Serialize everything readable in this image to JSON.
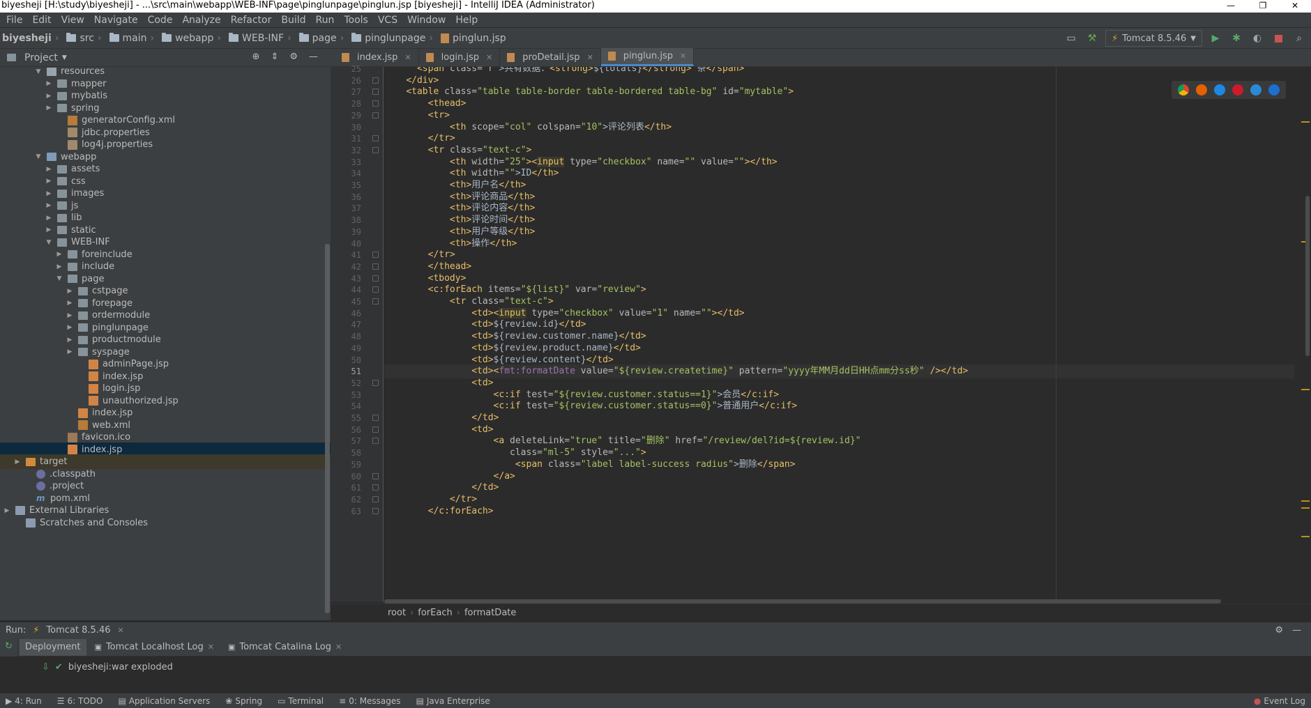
{
  "window": {
    "title": "biyesheji [H:\\study\\biyesheji] - ...\\src\\main\\webapp\\WEB-INF\\page\\pinglunpage\\pinglun.jsp [biyesheji] - IntelliJ IDEA (Administrator)"
  },
  "menu": [
    "File",
    "Edit",
    "View",
    "Navigate",
    "Code",
    "Analyze",
    "Refactor",
    "Build",
    "Run",
    "Tools",
    "VCS",
    "Window",
    "Help"
  ],
  "breadcrumb": [
    "biyesheji",
    "src",
    "main",
    "webapp",
    "WEB-INF",
    "page",
    "pinglunpage",
    "pinglun.jsp"
  ],
  "run_config": "Tomcat 8.5.46",
  "project_panel": {
    "title": "Project"
  },
  "tree": [
    {
      "label": "resources",
      "depth": 3,
      "kind": "fold res",
      "open": true
    },
    {
      "label": "mapper",
      "depth": 4,
      "kind": "fold",
      "open": false
    },
    {
      "label": "mybatis",
      "depth": 4,
      "kind": "fold",
      "open": false
    },
    {
      "label": "spring",
      "depth": 4,
      "kind": "fold",
      "open": false
    },
    {
      "label": "generatorConfig.xml",
      "depth": 5,
      "kind": "xml"
    },
    {
      "label": "jdbc.properties",
      "depth": 5,
      "kind": "prop"
    },
    {
      "label": "log4j.properties",
      "depth": 5,
      "kind": "prop"
    },
    {
      "label": "webapp",
      "depth": 3,
      "kind": "fold web",
      "open": true
    },
    {
      "label": "assets",
      "depth": 4,
      "kind": "fold",
      "open": false
    },
    {
      "label": "css",
      "depth": 4,
      "kind": "fold",
      "open": false
    },
    {
      "label": "images",
      "depth": 4,
      "kind": "fold",
      "open": false
    },
    {
      "label": "js",
      "depth": 4,
      "kind": "fold",
      "open": false
    },
    {
      "label": "lib",
      "depth": 4,
      "kind": "fold",
      "open": false
    },
    {
      "label": "static",
      "depth": 4,
      "kind": "fold",
      "open": false
    },
    {
      "label": "WEB-INF",
      "depth": 4,
      "kind": "fold",
      "open": true
    },
    {
      "label": "foreinclude",
      "depth": 5,
      "kind": "fold",
      "open": false
    },
    {
      "label": "include",
      "depth": 5,
      "kind": "fold",
      "open": false
    },
    {
      "label": "page",
      "depth": 5,
      "kind": "fold",
      "open": true
    },
    {
      "label": "cstpage",
      "depth": 6,
      "kind": "fold",
      "open": false
    },
    {
      "label": "forepage",
      "depth": 6,
      "kind": "fold",
      "open": false
    },
    {
      "label": "ordermodule",
      "depth": 6,
      "kind": "fold",
      "open": false
    },
    {
      "label": "pinglunpage",
      "depth": 6,
      "kind": "fold",
      "open": false
    },
    {
      "label": "productmodule",
      "depth": 6,
      "kind": "fold",
      "open": false
    },
    {
      "label": "syspage",
      "depth": 6,
      "kind": "fold",
      "open": false
    },
    {
      "label": "adminPage.jsp",
      "depth": 7,
      "kind": "jsp"
    },
    {
      "label": "index.jsp",
      "depth": 7,
      "kind": "jsp"
    },
    {
      "label": "login.jsp",
      "depth": 7,
      "kind": "jsp"
    },
    {
      "label": "unauthorized.jsp",
      "depth": 7,
      "kind": "jsp"
    },
    {
      "label": "index.jsp",
      "depth": 6,
      "kind": "jsp"
    },
    {
      "label": "web.xml",
      "depth": 6,
      "kind": "xml"
    },
    {
      "label": "favicon.ico",
      "depth": 5,
      "kind": "ico"
    },
    {
      "label": "index.jsp",
      "depth": 5,
      "kind": "jsp",
      "selected": true
    },
    {
      "label": "target",
      "depth": 1,
      "kind": "fold target",
      "open": false,
      "highlight": true
    },
    {
      "label": ".classpath",
      "depth": 2,
      "kind": "cp"
    },
    {
      "label": ".project",
      "depth": 2,
      "kind": "cp"
    },
    {
      "label": "pom.xml",
      "depth": 2,
      "kind": "pom"
    },
    {
      "label": "External Libraries",
      "depth": 0,
      "kind": "lib",
      "open": false
    },
    {
      "label": "Scratches and Consoles",
      "depth": 1,
      "kind": "lib"
    }
  ],
  "tabs": [
    {
      "label": "index.jsp",
      "active": false
    },
    {
      "label": "login.jsp",
      "active": false
    },
    {
      "label": "proDetail.jsp",
      "active": false
    },
    {
      "label": "pinglun.jsp",
      "active": true
    }
  ],
  "code": {
    "first_line": 25,
    "current_line": 51,
    "lines": [
      [
        [
          "      ",
          "x"
        ],
        [
          "<span ",
          "t"
        ],
        [
          "class=",
          "a"
        ],
        [
          "\"r\"",
          "s"
        ],
        [
          ">共有数据：",
          "x"
        ],
        [
          "<strong>",
          "t"
        ],
        [
          "${totals}",
          "x"
        ],
        [
          "</strong>",
          "t"
        ],
        [
          " 条",
          "x"
        ],
        [
          "</span>",
          "t"
        ]
      ],
      [
        [
          "    ",
          "x"
        ],
        [
          "</div>",
          "t"
        ]
      ],
      [
        [
          "    ",
          "x"
        ],
        [
          "<table ",
          "t"
        ],
        [
          "class=",
          "a"
        ],
        [
          "\"table table-border table-bordered table-bg\"",
          "s"
        ],
        [
          " id=",
          "a"
        ],
        [
          "\"mytable\"",
          "s"
        ],
        [
          ">",
          "t"
        ]
      ],
      [
        [
          "        ",
          "x"
        ],
        [
          "<thead>",
          "t"
        ]
      ],
      [
        [
          "        ",
          "x"
        ],
        [
          "<tr>",
          "t"
        ]
      ],
      [
        [
          "            ",
          "x"
        ],
        [
          "<th ",
          "t"
        ],
        [
          "scope=",
          "a"
        ],
        [
          "\"col\"",
          "s"
        ],
        [
          " colspan=",
          "a"
        ],
        [
          "\"10\"",
          "s"
        ],
        [
          ">评论列表",
          "x"
        ],
        [
          "</th>",
          "t"
        ]
      ],
      [
        [
          "        ",
          "x"
        ],
        [
          "</tr>",
          "t"
        ]
      ],
      [
        [
          "        ",
          "x"
        ],
        [
          "<tr ",
          "t"
        ],
        [
          "class=",
          "a"
        ],
        [
          "\"text-c\"",
          "s"
        ],
        [
          ">",
          "t"
        ]
      ],
      [
        [
          "            ",
          "x"
        ],
        [
          "<th ",
          "t"
        ],
        [
          "width=",
          "a"
        ],
        [
          "\"25\"",
          "s"
        ],
        [
          "><",
          "t"
        ],
        [
          "input",
          "t"
        ],
        [
          " type=",
          "a"
        ],
        [
          "\"checkbox\"",
          "s"
        ],
        [
          " name=",
          "a"
        ],
        [
          "\"\"",
          "s"
        ],
        [
          " value=",
          "a"
        ],
        [
          "\"\"",
          "s"
        ],
        [
          "></th>",
          "t"
        ]
      ],
      [
        [
          "            ",
          "x"
        ],
        [
          "<th ",
          "t"
        ],
        [
          "width=",
          "a"
        ],
        [
          "\"\"",
          "s"
        ],
        [
          ">ID",
          "x"
        ],
        [
          "</th>",
          "t"
        ]
      ],
      [
        [
          "            ",
          "x"
        ],
        [
          "<th>",
          "t"
        ],
        [
          "用户名",
          "x"
        ],
        [
          "</th>",
          "t"
        ]
      ],
      [
        [
          "            ",
          "x"
        ],
        [
          "<th>",
          "t"
        ],
        [
          "评论商品",
          "x"
        ],
        [
          "</th>",
          "t"
        ]
      ],
      [
        [
          "            ",
          "x"
        ],
        [
          "<th>",
          "t"
        ],
        [
          "评论内容",
          "x"
        ],
        [
          "</th>",
          "t"
        ]
      ],
      [
        [
          "            ",
          "x"
        ],
        [
          "<th>",
          "t"
        ],
        [
          "评论时间",
          "x"
        ],
        [
          "</th>",
          "t"
        ]
      ],
      [
        [
          "            ",
          "x"
        ],
        [
          "<th>",
          "t"
        ],
        [
          "用户等级",
          "x"
        ],
        [
          "</th>",
          "t"
        ]
      ],
      [
        [
          "            ",
          "x"
        ],
        [
          "<th>",
          "t"
        ],
        [
          "操作",
          "x"
        ],
        [
          "</th>",
          "t"
        ]
      ],
      [
        [
          "        ",
          "x"
        ],
        [
          "</tr>",
          "t"
        ]
      ],
      [
        [
          "        ",
          "x"
        ],
        [
          "</thead>",
          "t"
        ]
      ],
      [
        [
          "        ",
          "x"
        ],
        [
          "<tbody>",
          "t"
        ]
      ],
      [
        [
          "        ",
          "x"
        ],
        [
          "<c:forEach ",
          "t"
        ],
        [
          "items=",
          "a"
        ],
        [
          "\"${list}\"",
          "s"
        ],
        [
          " var=",
          "a"
        ],
        [
          "\"review\"",
          "s"
        ],
        [
          ">",
          "t"
        ]
      ],
      [
        [
          "            ",
          "x"
        ],
        [
          "<tr ",
          "t"
        ],
        [
          "class=",
          "a"
        ],
        [
          "\"text-c\"",
          "s"
        ],
        [
          ">",
          "t"
        ]
      ],
      [
        [
          "                ",
          "x"
        ],
        [
          "<td><",
          "t"
        ],
        [
          "input",
          "t"
        ],
        [
          " type=",
          "a"
        ],
        [
          "\"checkbox\"",
          "s"
        ],
        [
          " value=",
          "a"
        ],
        [
          "\"1\"",
          "s"
        ],
        [
          " name=",
          "a"
        ],
        [
          "\"\"",
          "s"
        ],
        [
          "></td>",
          "t"
        ]
      ],
      [
        [
          "                ",
          "x"
        ],
        [
          "<td>",
          "t"
        ],
        [
          "${review.id}",
          "x"
        ],
        [
          "</td>",
          "t"
        ]
      ],
      [
        [
          "                ",
          "x"
        ],
        [
          "<td>",
          "t"
        ],
        [
          "${review.customer.name}",
          "x"
        ],
        [
          "</td>",
          "t"
        ]
      ],
      [
        [
          "                ",
          "x"
        ],
        [
          "<td>",
          "t"
        ],
        [
          "${review.product.name}",
          "x"
        ],
        [
          "</td>",
          "t"
        ]
      ],
      [
        [
          "                ",
          "x"
        ],
        [
          "<td>",
          "t"
        ],
        [
          "${review.content}",
          "x"
        ],
        [
          "</td>",
          "t"
        ]
      ],
      [
        [
          "                ",
          "x"
        ],
        [
          "<td><",
          "t"
        ],
        [
          "fmt:formatDate",
          "ns"
        ],
        [
          " value=",
          "a"
        ],
        [
          "\"${review.createtime}\"",
          "s"
        ],
        [
          " pattern=",
          "a"
        ],
        [
          "\"yyyy年MM月dd日HH点mm分ss秒\"",
          "s"
        ],
        [
          " /></td>",
          "t"
        ]
      ],
      [
        [
          "                ",
          "x"
        ],
        [
          "<td>",
          "t"
        ]
      ],
      [
        [
          "                    ",
          "x"
        ],
        [
          "<c:if ",
          "t"
        ],
        [
          "test=",
          "a"
        ],
        [
          "\"${review.customer.status==1}\"",
          "s"
        ],
        [
          ">会员",
          "x"
        ],
        [
          "</c:if>",
          "t"
        ]
      ],
      [
        [
          "                    ",
          "x"
        ],
        [
          "<c:if ",
          "t"
        ],
        [
          "test=",
          "a"
        ],
        [
          "\"${review.customer.status==0}\"",
          "s"
        ],
        [
          ">普通用户",
          "x"
        ],
        [
          "</c:if>",
          "t"
        ]
      ],
      [
        [
          "                ",
          "x"
        ],
        [
          "</td>",
          "t"
        ]
      ],
      [
        [
          "                ",
          "x"
        ],
        [
          "<td>",
          "t"
        ]
      ],
      [
        [
          "                    ",
          "x"
        ],
        [
          "<a ",
          "t"
        ],
        [
          "deleteLink=",
          "a"
        ],
        [
          "\"true\"",
          "s"
        ],
        [
          " title=",
          "a"
        ],
        [
          "\"删除\"",
          "s"
        ],
        [
          " href=",
          "a"
        ],
        [
          "\"/review/del?id=${review.id}\"",
          "s"
        ]
      ],
      [
        [
          "                       ",
          "x"
        ],
        [
          "class=",
          "a"
        ],
        [
          "\"ml-5\"",
          "s"
        ],
        [
          " style=",
          "a"
        ],
        [
          "\"...\"",
          "s"
        ],
        [
          ">",
          "t"
        ]
      ],
      [
        [
          "                        ",
          "x"
        ],
        [
          "<span ",
          "t"
        ],
        [
          "class=",
          "a"
        ],
        [
          "\"label label-success radius\"",
          "s"
        ],
        [
          ">删除",
          "x"
        ],
        [
          "</span>",
          "t"
        ]
      ],
      [
        [
          "                    ",
          "x"
        ],
        [
          "</a>",
          "t"
        ]
      ],
      [
        [
          "                ",
          "x"
        ],
        [
          "</td>",
          "t"
        ]
      ],
      [
        [
          "            ",
          "x"
        ],
        [
          "</tr>",
          "t"
        ]
      ],
      [
        [
          "        ",
          "x"
        ],
        [
          "</c:forEach>",
          "t"
        ]
      ]
    ]
  },
  "editor_breadcrumb": [
    "root",
    "forEach",
    "formatDate"
  ],
  "run_panel": {
    "label": "Run:",
    "config": "Tomcat 8.5.46",
    "tabs": [
      "Deployment",
      "Tomcat Localhost Log",
      "Tomcat Catalina Log"
    ],
    "deployment": "biyesheji:war exploded"
  },
  "statusbar": [
    "4: Run",
    "6: TODO",
    "Application Servers",
    "Spring",
    "Terminal",
    "0: Messages",
    "Java Enterprise",
    "Event Log"
  ]
}
